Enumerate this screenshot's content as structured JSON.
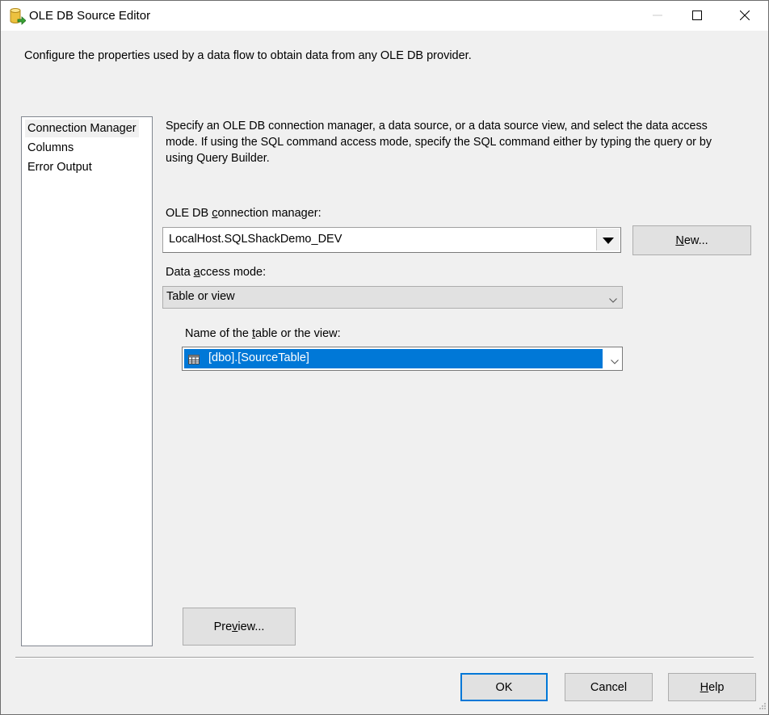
{
  "window": {
    "title": "OLE DB Source Editor",
    "title_icon": "database-source-icon",
    "controls": {
      "minimize_icon": "minimize-icon",
      "maximize_icon": "maximize-icon",
      "close_icon": "close-icon"
    }
  },
  "description": "Configure the properties used by a data flow to obtain data from any OLE DB provider.",
  "sidebar": {
    "items": [
      {
        "label": "Connection Manager",
        "selected": true
      },
      {
        "label": "Columns",
        "selected": false
      },
      {
        "label": "Error Output",
        "selected": false
      }
    ]
  },
  "main": {
    "info_text": "Specify an OLE DB connection manager, a data source, or a data source view, and select the data access mode. If using the SQL command access mode, specify the SQL command either by typing the query or by using Query Builder.",
    "connection_manager": {
      "label_pre": "OLE DB ",
      "label_accel": "c",
      "label_post": "onnection manager:",
      "value": "LocalHost.SQLShackDemo_DEV",
      "new_button": {
        "accel": "N",
        "rest": "ew..."
      }
    },
    "data_access_mode": {
      "label_pre": "Data ",
      "label_accel": "a",
      "label_post": "ccess mode:",
      "value": "Table or view"
    },
    "table_name": {
      "label_pre": "Name of the ",
      "label_accel": "t",
      "label_post": "able or the view:",
      "value": "[dbo].[SourceTable]",
      "icon": "table-icon"
    },
    "preview_button": {
      "pre": "Pre",
      "accel": "v",
      "post": "iew..."
    }
  },
  "footer": {
    "ok_label": "OK",
    "cancel_label": "Cancel",
    "help_button": {
      "accel": "H",
      "rest": "elp"
    }
  },
  "colors": {
    "accent": "#0078d7",
    "dialog_bg": "#f0f0f0",
    "button_bg": "#e1e1e1"
  }
}
